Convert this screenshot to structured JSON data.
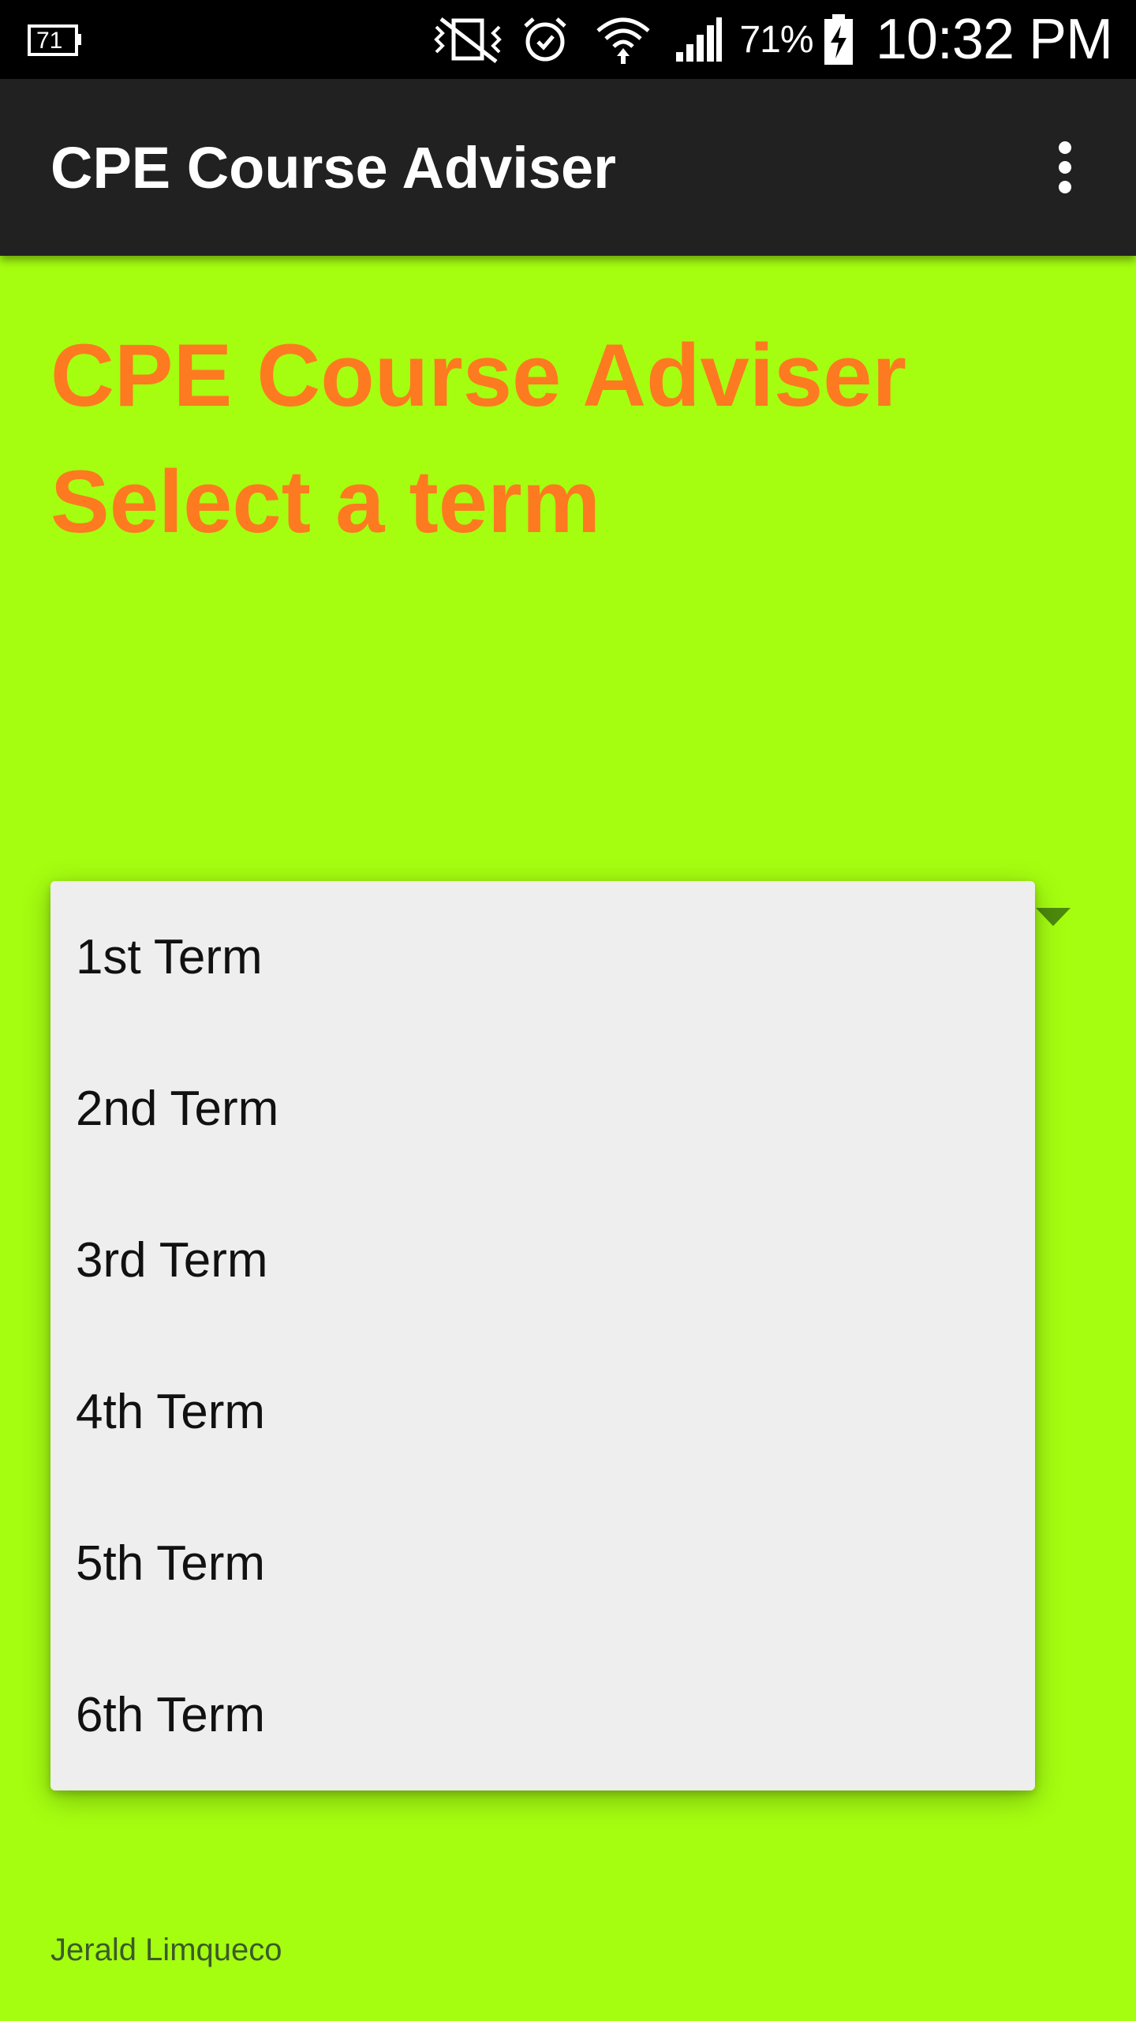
{
  "status_bar": {
    "battery_percent": "71%",
    "time": "10:32 PM",
    "icons": [
      "notification-71-icon",
      "vibrate-icon",
      "alarm-icon",
      "wifi-icon",
      "cell-signal-icon",
      "battery-charging-icon"
    ]
  },
  "app_bar": {
    "title": "CPE Course Adviser"
  },
  "main": {
    "heading_line1": "CPE Course Adviser",
    "heading_line2": "Select a term"
  },
  "dropdown": {
    "options": [
      "1st Term",
      "2nd Term",
      "3rd Term",
      "4th Term",
      "5th Term",
      "6th Term"
    ]
  },
  "footer": {
    "author": "Jerald Limqueco"
  },
  "colors": {
    "background": "#a5fe10",
    "heading": "#fe7a20",
    "app_bar": "#212121",
    "dropdown_bg": "#eeeeee"
  }
}
